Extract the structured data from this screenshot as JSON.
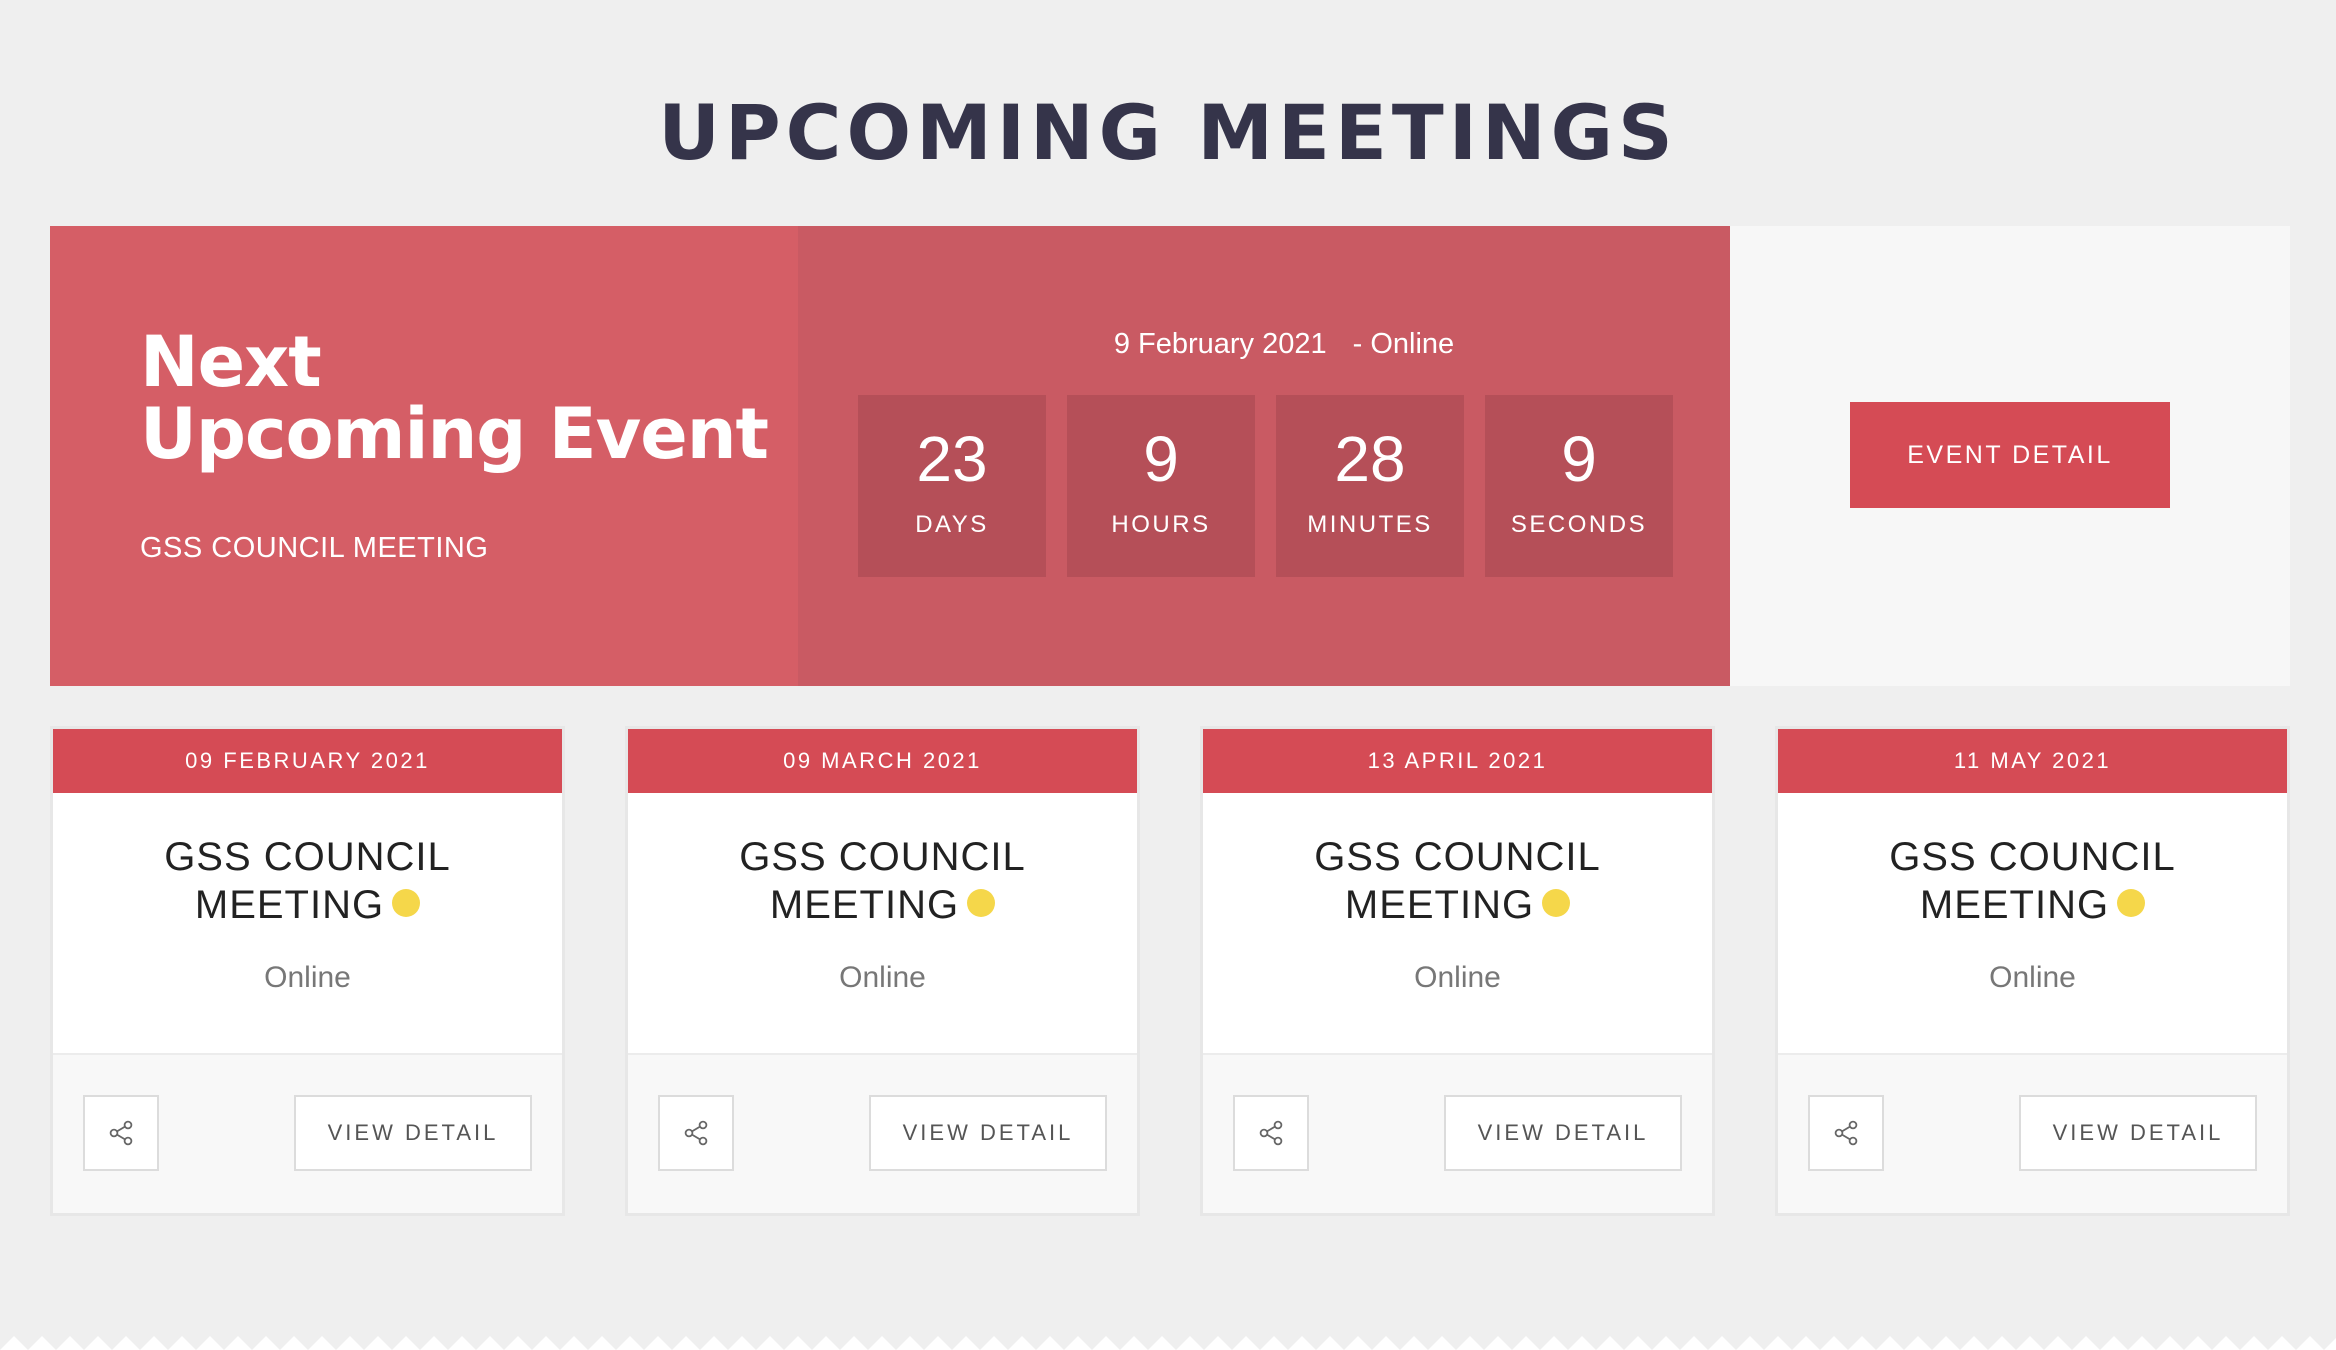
{
  "page": {
    "title": "UPCOMING MEETINGS"
  },
  "hero": {
    "heading_line1": "Next",
    "heading_line2": "Upcoming Event",
    "subtitle": "GSS COUNCIL MEETING",
    "date": "9 February 2021",
    "location": "- Online",
    "countdown": [
      {
        "value": "23",
        "label": "DAYS"
      },
      {
        "value": "9",
        "label": "HOURS"
      },
      {
        "value": "28",
        "label": "MINUTES"
      },
      {
        "value": "9",
        "label": "SECONDS"
      }
    ],
    "button_label": "EVENT DETAIL"
  },
  "cards": [
    {
      "date": "09 FEBRUARY 2021",
      "title": "GSS COUNCIL MEETING",
      "location": "Online",
      "button_label": "VIEW DETAIL",
      "share_icon": "share-icon"
    },
    {
      "date": "09 MARCH 2021",
      "title": "GSS COUNCIL MEETING",
      "location": "Online",
      "button_label": "VIEW DETAIL",
      "share_icon": "share-icon"
    },
    {
      "date": "13 APRIL 2021",
      "title": "GSS COUNCIL MEETING",
      "location": "Online",
      "button_label": "VIEW DETAIL",
      "share_icon": "share-icon"
    },
    {
      "date": "11 MAY 2021",
      "title": "GSS COUNCIL MEETING",
      "location": "Online",
      "button_label": "VIEW DETAIL",
      "share_icon": "share-icon"
    }
  ],
  "colors": {
    "accent": "#d54b55",
    "hero_left": "#d55e66",
    "hero_mid": "#c95a63",
    "countdown_box": "#b54f58",
    "status_dot": "#f5d74a",
    "title": "#35344a"
  }
}
